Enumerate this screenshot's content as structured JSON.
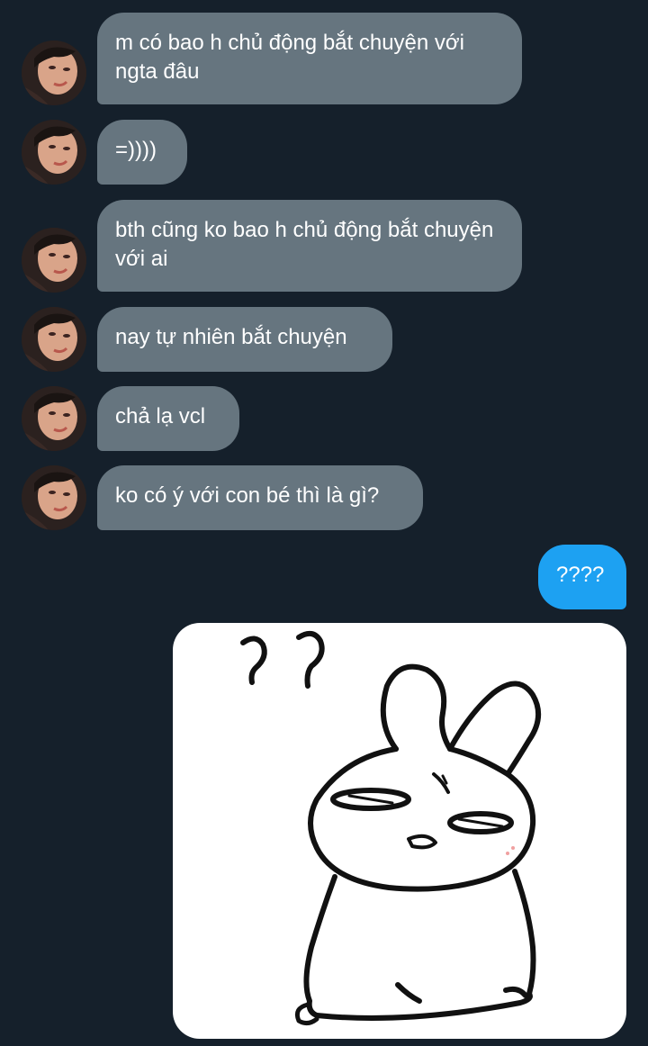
{
  "conversation": {
    "incoming": [
      {
        "text": "m có bao h chủ động bắt chuyện với ngta đâu"
      },
      {
        "text": "=))))"
      },
      {
        "text": "bth cũng ko bao h chủ động bắt chuyện với ai"
      },
      {
        "text": "nay tự nhiên bắt chuyện"
      },
      {
        "text": "chả lạ vcl"
      },
      {
        "text": "ko có ý với con bé thì là gì?"
      }
    ],
    "outgoing": [
      {
        "text": "????"
      }
    ],
    "sticker": {
      "icon": "confused-bunny-sticker",
      "question_marks": [
        "?",
        "?"
      ]
    }
  },
  "colors": {
    "background": "#15202b",
    "incoming_bubble": "#66757f",
    "outgoing_bubble": "#1da1f2"
  }
}
